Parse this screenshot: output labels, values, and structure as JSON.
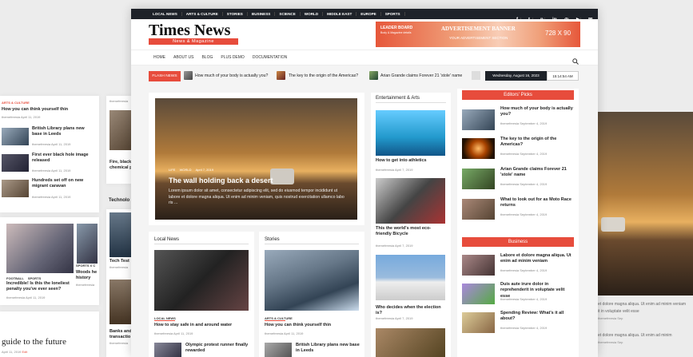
{
  "topbar": {
    "nav": [
      "LOCAL NEWS",
      "ARTS & CULTURE",
      "STORIES",
      "BUSINESS",
      "SCIENCE",
      "WORLD",
      "MIDDLE EAST",
      "EUROPE",
      "SPORTS"
    ],
    "social_icons": [
      "facebook-icon",
      "twitter-icon",
      "pinterest-icon",
      "linkedin-icon",
      "instagram-icon",
      "youtube-icon",
      "mail-icon"
    ]
  },
  "logo": {
    "title": "Times News",
    "tagline": "News & Magazine"
  },
  "banner": {
    "label": "LEADER BOARD",
    "sub": "Body & Magazine details",
    "main": "ADVERTISEMENT BANNER",
    "hint": "YOUR ADVERTISEMENT SECTION",
    "size": "728 X 90"
  },
  "menu": [
    "HOME",
    "ABOUT US",
    "BLOG",
    "PLUS DEMO",
    "DOCUMENTATION"
  ],
  "ticker": {
    "label": "FLASH NEWS",
    "items": [
      "How much of your body is actually you?",
      "The key to the origin of the Americas?",
      "Arian Grande claims Forever 21 'stole' name"
    ],
    "date": "Wednesday, August 16, 2023",
    "time": "15:14:54 AM"
  },
  "hero": {
    "tags": [
      "LIFE",
      "WORLD"
    ],
    "date": "April 7, 2019",
    "title": "The wall holding back a desert",
    "excerpt": "Lorem ipsum dolor sit amet, consectetur adipiscing elit, sed do eiusmod tempor incididunt ut labore et dolore magna aliqua. Ut enim ad minim veniam, quis nostrud exercitation ullamco labo ris ..."
  },
  "local": {
    "title": "Local News",
    "tag": "LOCAL NEWS",
    "headline": "How to stay safe in and around water",
    "meta": "themefreesia  April 11, 2019",
    "next": "Olympic protest runner finally rewarded"
  },
  "stories": {
    "title": "Stories",
    "tag": "ARTS & CULTURE",
    "headline": "How you can think yourself thin",
    "meta": "themefreesia  April 11, 2019",
    "next": "British Library plans new base in Leeds"
  },
  "arts": {
    "title": "Entertainment & Arts",
    "items": [
      {
        "title": "How to get into athletics",
        "meta": "themefreesia  April 7, 2019"
      },
      {
        "title": "This the world's most eco-friendly Bicycle",
        "meta": "themefreesia  April 7, 2019"
      },
      {
        "title": "Who decides when the election is?",
        "meta": "themefreesia  April 7, 2019"
      }
    ]
  },
  "editors": {
    "title": "Editors' Picks",
    "items": [
      {
        "title": "How much of your body is actually you?",
        "meta": "themefreesia  September 4, 2019"
      },
      {
        "title": "The key to the origin of the Americas?",
        "meta": "themefreesia  September 4, 2019"
      },
      {
        "title": "Arian Grande claims Forever 21 'stole' name",
        "meta": "themefreesia  September 4, 2019"
      },
      {
        "title": "What to look out for as Moto Race returns",
        "meta": "themefreesia  September 4, 2019"
      }
    ]
  },
  "business": {
    "title": "Business",
    "items": [
      {
        "title": "Labore et dolore magna aliqua. Ut enim ad minim veniam",
        "meta": "themefreesia  September 4, 2019"
      },
      {
        "title": "Duis aute irure dolor in reprehenderit in voluptate velit esse",
        "meta": "themefreesia  September 4, 2019"
      },
      {
        "title": "Spending Review: What's it all about?",
        "meta": "themefreesia  September 4, 2019"
      }
    ]
  },
  "left_bg": {
    "cat": "ARTS & CULTURE",
    "head": "How you can think yourself thin",
    "meta": "themefreesia  April 11, 2019",
    "items": [
      {
        "title": "British Library plans new base in Leeds",
        "meta": "themefreesia  April 11, 2019"
      },
      {
        "title": "First ever black hole image released",
        "meta": "themefreesia  April 11, 2019"
      },
      {
        "title": "Hundreds set off on new migrant caravan",
        "meta": "themefreesia  April 11, 2019"
      }
    ],
    "cats2": [
      "FOOTBALL",
      "SPORTS"
    ],
    "head2": "Incredible! Is this the loneliest penalty you've ever seen?",
    "meta2": "themefreesia  April 11, 2019",
    "big": "guide to the future",
    "bigmeta": "April 11, 2019",
    "edit": "Edit"
  },
  "mid_bg": {
    "meta1": "themefreesia",
    "t1a": "Fire, black",
    "t1b": "chemical p",
    "label": "Technolo",
    "tech": "Tech Test",
    "meta2": "themefreesia",
    "banks": "Banks and",
    "trans": "transactio",
    "meta3": "themefreesia",
    "cat": "SPORTS  X C",
    "woods": "Woods he",
    "hist": "history",
    "meta4": "themefreesia"
  },
  "right_bg": {
    "lines": [
      "et dolore magna aliqua. Ut enim ad minim veniam",
      "it in voluptate velit esse",
      "themefreesia  Sep",
      "et dolore magna aliqua. Ut enim ad minim",
      "themefreesia  Sep"
    ]
  },
  "colors": {
    "accent": "#e74c3c",
    "dark": "#1e2229"
  }
}
